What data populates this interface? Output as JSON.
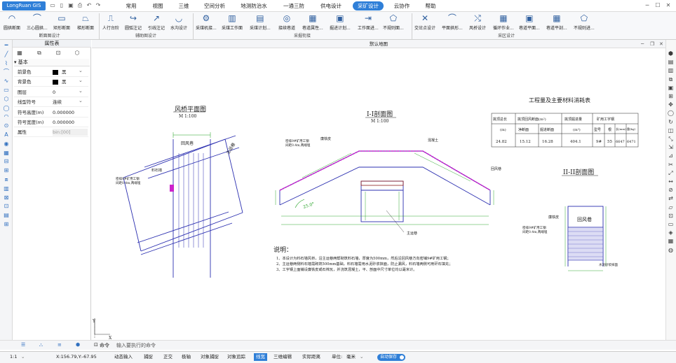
{
  "app": {
    "logo": "LongRuan GIS"
  },
  "menu": [
    "常用",
    "视图",
    "三维",
    "空间分析",
    "地测防治水",
    "一通三防",
    "供电设计",
    "采矿设计",
    "云协作",
    "帮助"
  ],
  "menu_active": "采矿设计",
  "ribbon": {
    "buttons": [
      "圆拱断面",
      "三心圆拱...",
      "矩形断面",
      "梯形断面",
      "人行台阶",
      "圆弧注记",
      "引线注记",
      "水沟设计",
      "采煤机接...",
      "采煤工作面",
      "采煤计划...",
      "接续巷道",
      "巷道属性...",
      "掘进计划...",
      "工作面进...",
      "不规则面...",
      "交岔点设计",
      "平面拱形...",
      "风桥设计",
      "循环作业...",
      "巷道平面...",
      "巷道平剖...",
      "不规则进..."
    ],
    "groups": [
      "断面图设计",
      "辅助图设计",
      "采掘衔接",
      "采区设计"
    ]
  },
  "panel": {
    "title": "属性表",
    "section": "基本",
    "rows": [
      {
        "label": "前景色",
        "value": "黑",
        "swatch": true
      },
      {
        "label": "背景色",
        "value": "黑",
        "swatch": true
      },
      {
        "label": "图层",
        "value": "0"
      },
      {
        "label": "线型符号",
        "value": "连续"
      },
      {
        "label": "符号高度(m)",
        "value": "0.000000"
      },
      {
        "label": "符号宽度(m)",
        "value": "0.000000"
      },
      {
        "label": "属性",
        "value": "bin:[00]"
      }
    ]
  },
  "canvas": {
    "tab": "默认地图"
  },
  "drawing": {
    "plan_title": "风桥平面图",
    "plan_scale": "M 1:100",
    "section1_title": "I-I剖面图",
    "section1_scale": "M 1:100",
    "section2_title": "II-II剖面图",
    "table_title": "工程量及主要材料消耗表",
    "table_headers": [
      "挑顶总长",
      "挑顶回风断面(m²)",
      "挑顶掘进量",
      "矿用工字钢"
    ],
    "table_sub": [
      "(m)",
      "净断面",
      "掘进断面",
      "(m³)",
      "型号",
      "根",
      "长(mm)",
      "重(kg)"
    ],
    "table_row": [
      "24.82",
      "15.12",
      "16.28",
      "404.1",
      "9#",
      "55",
      "6647",
      "6471"
    ],
    "labels": {
      "huifeng": "回风巷",
      "zhuyun": "主运巷",
      "liaoshi": "料石墙",
      "mizhi": "密排9#矿用工钢",
      "jianju": "间距0.4m,两端埋",
      "lianwu": "廉铁皮",
      "hunningtu": "混凝土",
      "waterproof": "水泥砂浆抹面",
      "angle": "25.0°"
    },
    "notes_title": "说明：",
    "notes": [
      "1、本设计为料石墙风桥，沿主运巷两帮砌筑料石墙，厚度为500mm，然后沿回风巷方向密铺9#矿用工钢；",
      "2、主运巷两侧料石墙需砌筑500mm基础，料石墙需用水泥砂浆抹面，防止漏风，料石墙两侧可用矸石填充；",
      "3、工字钢上面铺设廉铁皮或石棉瓦，并浇筑混凝土，平、剖面中尺寸单位均以毫米计。"
    ]
  },
  "command": {
    "label": "命令",
    "placeholder": "输入要执行的命令"
  },
  "status": {
    "scale": "1:1",
    "coords": "X:156.79,Y:-67.95",
    "toggles": [
      "动态输入",
      "捕捉",
      "正交",
      "极轴",
      "对象捕捉",
      "对象追踪",
      "线宽",
      "三维编辑",
      "实际距离"
    ],
    "active_toggle": "线宽",
    "unit_label": "单位:",
    "unit": "毫米",
    "autosave": "自动保存"
  },
  "colors": {
    "accent": "#2f7fd8",
    "drawing_blue": "#2b2fb0",
    "dim_green": "#1a9e1a",
    "magenta": "#cc22cc",
    "dark_red": "#8b1a1a"
  }
}
